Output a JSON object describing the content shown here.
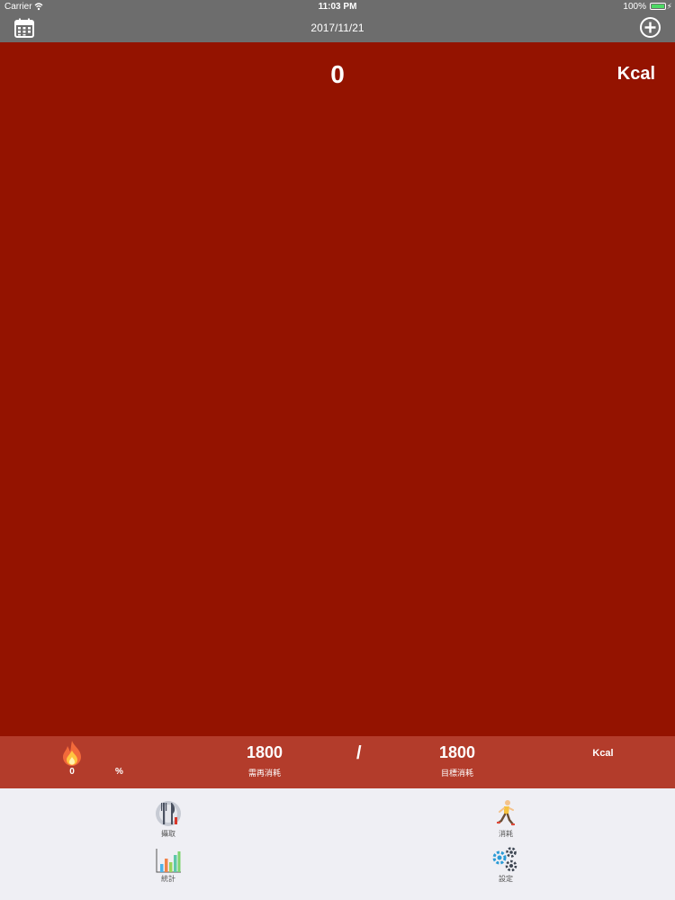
{
  "status_bar": {
    "carrier": "Carrier",
    "time": "11:03 PM",
    "battery": "100%"
  },
  "nav": {
    "title": "2017/11/21",
    "left_icon": "calendar-icon",
    "right_icon": "add-circle-icon"
  },
  "main": {
    "calorie_value": "0",
    "unit": "Kcal",
    "background": "#941300"
  },
  "summary": {
    "percent_value": "0",
    "percent_sign": "%",
    "remaining_value": "1800",
    "remaining_label": "需再消耗",
    "separator": "/",
    "target_value": "1800",
    "target_label": "目標消耗",
    "unit": "Kcal",
    "background": "#b33c2b"
  },
  "tabs": [
    {
      "label": "攝取",
      "icon": "utensils-icon"
    },
    {
      "label": "消耗",
      "icon": "runner-icon"
    },
    {
      "label": "統計",
      "icon": "bar-chart-icon"
    },
    {
      "label": "設定",
      "icon": "gears-icon"
    }
  ]
}
